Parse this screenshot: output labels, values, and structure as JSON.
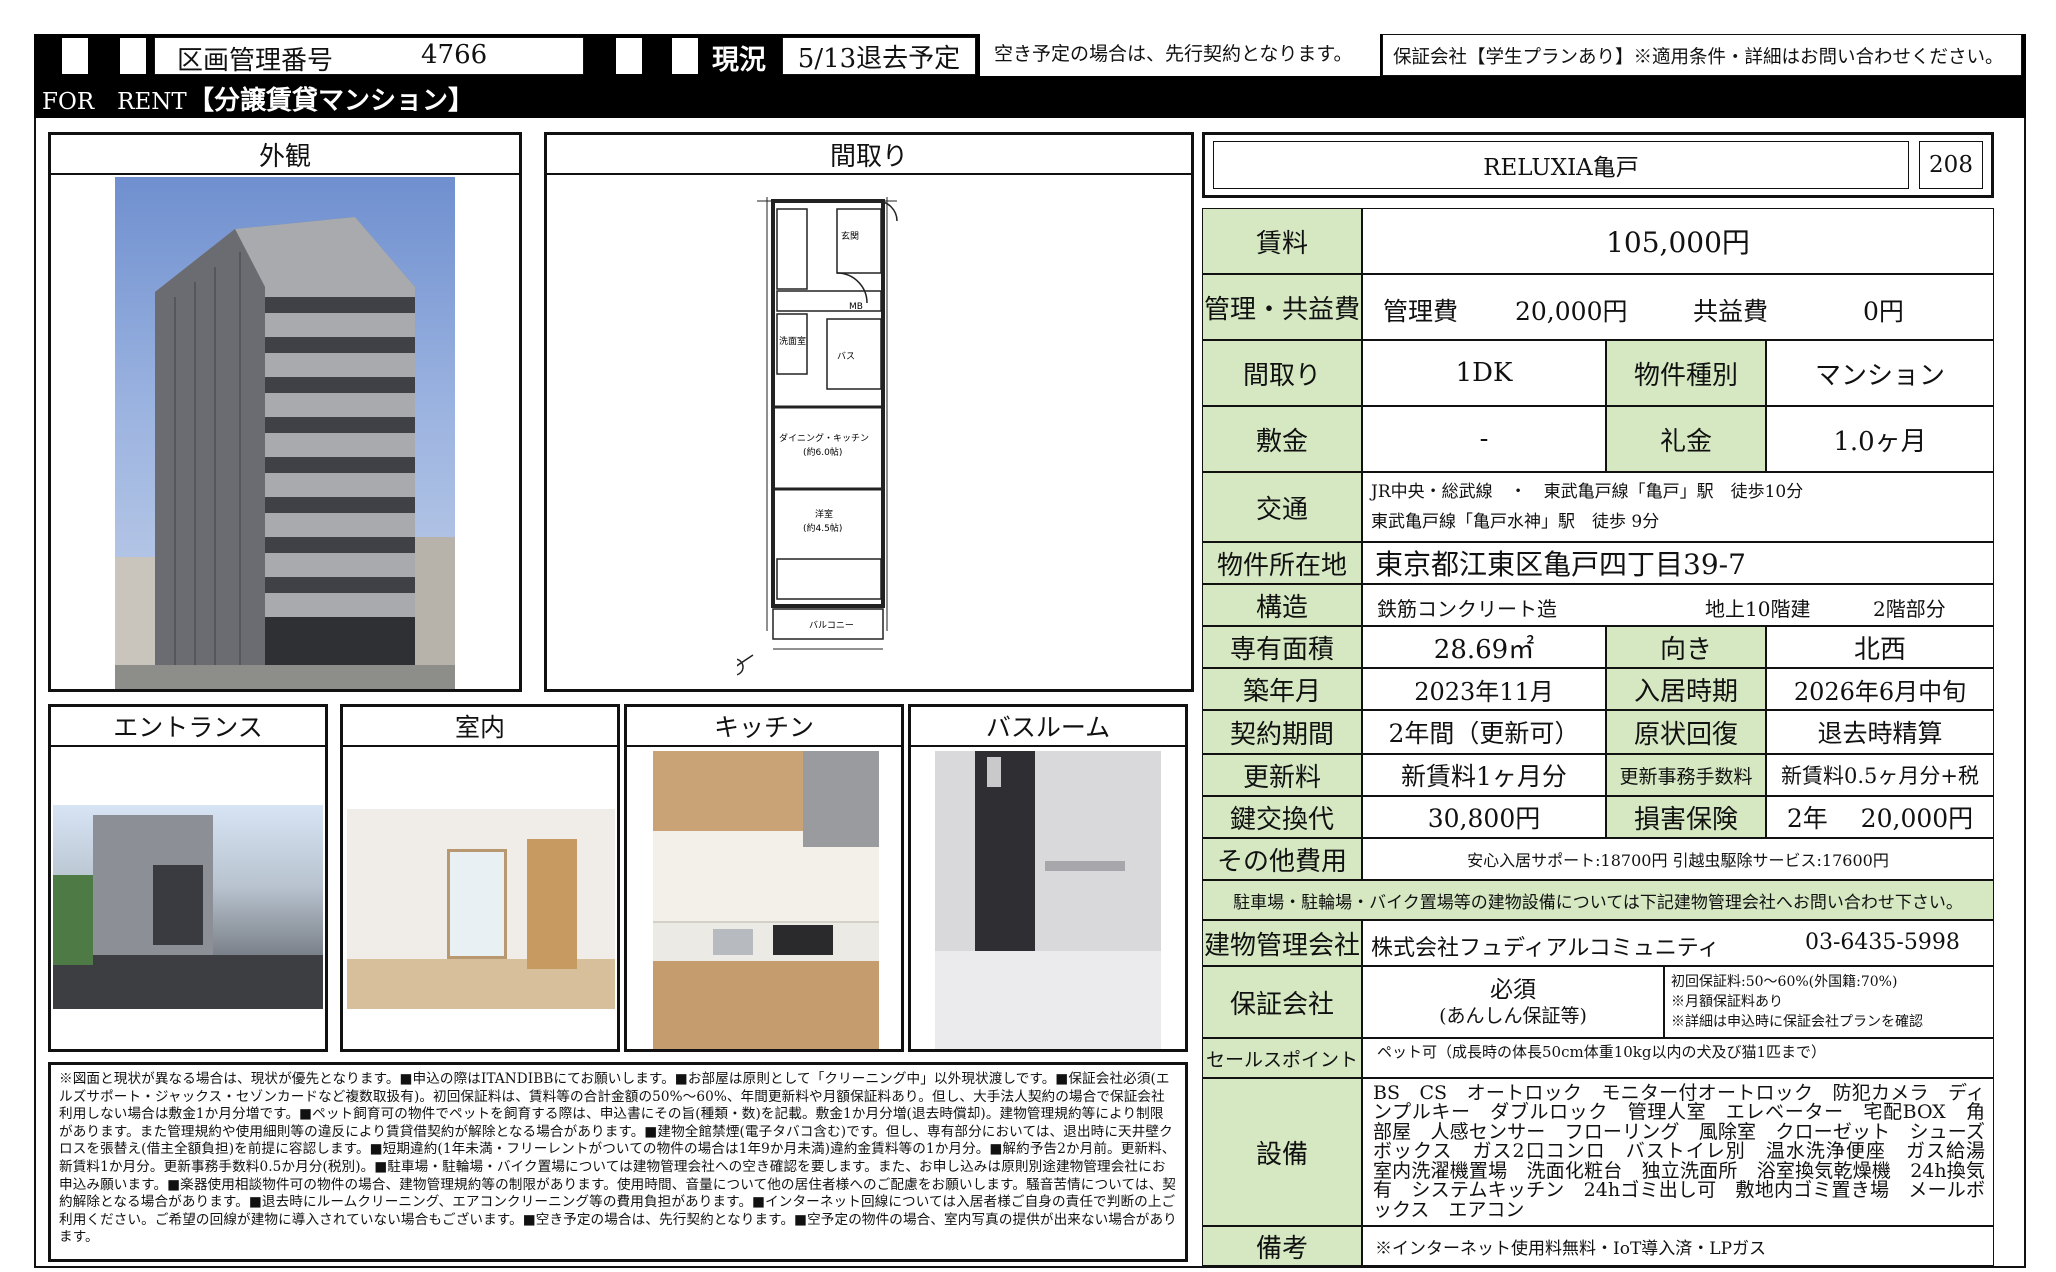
{
  "header": {
    "kukaku_label": "区画管理番号",
    "kukaku_value": "4766",
    "genkyo_label": "現況",
    "genkyo_value": "5/13退去予定",
    "vacancy_note": "空き予定の場合は、先行契約となります。",
    "guarantee_note": "保証会社【学生プランあり】※適用条件・詳細はお問い合わせください。",
    "for_rent": "FOR　RENT",
    "property_type": "【分譲賃貸マンション】"
  },
  "sections": {
    "exterior": "外観",
    "floorplan": "間取り",
    "entrance": "エントランス",
    "interior": "室内",
    "kitchen": "キッチン",
    "bathroom": "バスルーム"
  },
  "floorplan_labels": {
    "entry": "玄関",
    "wash": "洗面室",
    "bath": "バス",
    "dk": "ダイニング・キッチン",
    "dk_size": "(約6.0帖)",
    "western": "洋室",
    "western_size": "(約4.5帖)",
    "balcony": "バルコニー",
    "mbx": "MB"
  },
  "property": {
    "name": "RELUXIA亀戸",
    "room": "208"
  },
  "table": {
    "rent_label": "賃料",
    "rent_value": "105,000円",
    "mgmt_label": "管理・共益費",
    "mgmt_fee_label": "管理費",
    "mgmt_fee_value": "20,000円",
    "common_label": "共益費",
    "common_value": "0円",
    "layout_label": "間取り",
    "layout_value": "1DK",
    "kind_label": "物件種別",
    "kind_value": "マンション",
    "deposit_label": "敷金",
    "deposit_value": "-",
    "key_money_label": "礼金",
    "key_money_value": "1.0ヶ月",
    "access_label": "交通",
    "access_line1": "JR中央・総武線　・　東武亀戸線「亀戸」駅　徒歩10分",
    "access_line2": "東武亀戸線「亀戸水神」駅　徒歩 9分",
    "address_label": "物件所在地",
    "address_value": "東京都江東区亀戸四丁目39-7",
    "structure_label": "構造",
    "structure_value": "鉄筋コンクリート造",
    "floors_value": "地上10階建",
    "floor_part": "2階部分",
    "area_label": "専有面積",
    "area_value": "28.69㎡",
    "direction_label": "向き",
    "direction_value": "北西",
    "built_label": "築年月",
    "built_value": "2023年11月",
    "movein_label": "入居時期",
    "movein_value": "2026年6月中旬",
    "term_label": "契約期間",
    "term_value": "2年間（更新可）",
    "restore_label": "原状回復",
    "restore_value": "退去時精算",
    "renew_label": "更新料",
    "renew_value": "新賃料1ヶ月分",
    "renew_fee_label": "更新事務手数料",
    "renew_fee_value": "新賃料0.5ヶ月分+税",
    "key_label": "鍵交換代",
    "key_value": "30,800円",
    "insurance_label": "損害保険",
    "insurance_value": "2年　 20,000円",
    "other_label": "その他費用",
    "other_value": "安心入居サポート:18700円 引越虫駆除サービス:17600円",
    "parking_note": "駐車場・駐輪場・バイク置場等の建物設備については下記建物管理会社へお問い合わせ下さい。",
    "mgmt_co_label": "建物管理会社",
    "mgmt_co_value": "株式会社フュディアルコミュニティ",
    "mgmt_co_tel": "03-6435-5998",
    "guarantor_label": "保証会社",
    "guarantor_value": "必須",
    "guarantor_sub": "(あんしん保証等)",
    "guarantor_note1": "初回保証料:50～60%(外国籍:70%)",
    "guarantor_note2": "※月額保証料あり",
    "guarantor_note3": "※詳細は申込時に保証会社プランを確認",
    "sales_label": "セールスポイント",
    "sales_value": "ペット可（成長時の体長50cm体重10kg以内の犬及び猫1匹まで）",
    "equip_label": "設備",
    "equip_value": "BS　CS　オートロック　モニター付オートロック　防犯カメラ　ディンプルキー　ダブルロック　管理人室　エレベーター　宅配BOX　角部屋　人感センサー　フローリング　風除室　クローゼット　シューズボックス　ガス2口コンロ　バストイレ別　温水洗浄便座　ガス給湯　室内洗濯機置場　洗面化粧台　独立洗面所　浴室換気乾燥機　24h換気有　システムキッチン　24hゴミ出し可　敷地内ゴミ置き場　メールボックス　エアコン",
    "remarks_label": "備考",
    "remarks_value": "※インターネット使用料無料・IoT導入済・LPガス"
  },
  "disclaimer": "※図面と現状が異なる場合は、現状が優先となります。■申込の際はITANDIBBにてお願いします。■お部屋は原則として「クリーニング中」以外現状渡しです。■保証会社必須(エルズサポート・ジャックス・セゾンカードなど複数取扱有)。初回保証料は、賃料等の合計金額の50%～60%、年間更新料や月額保証料あり。但し、大手法人契約の場合で保証会社利用しない場合は敷金1か月分増です。■ペット飼育可の物件でペットを飼育する際は、申込書にその旨(種類・数)を記載。敷金1か月分増(退去時償却)。建物管理規約等により制限があります。また管理規約や使用細則等の違反により賃貸借契約が解除となる場合があります。■建物全館禁煙(電子タバコ含む)です。但し、専有部分においては、退出時に天井壁クロスを張替え(借主全額負担)を前提に容認します。■短期違約(1年未満・フリーレントがついての物件の場合は1年9か月未満)違約金賃料等の1か月分。■解約予告2か月前。更新料、新賃料1か月分。更新事務手数料0.5か月分(税別)。■駐車場・駐輪場・バイク置場については建物管理会社への空き確認を要します。また、お申し込みは原則別途建物管理会社にお申込み願います。■楽器使用相談物件可の物件の場合、建物管理規約等の制限があります。使用時間、音量について他の居住者様へのご配慮をお願いします。騒音苦情については、契約解除となる場合があります。■退去時にルームクリーニング、エアコンクリーニング等の費用負担があります。■インターネット回線については入居者様ご自身の責任で判断の上ご利用ください。ご希望の回線が建物に導入されていない場合もございます。■空き予定の場合は、先行契約となります。■空予定の物件の場合、室内写真の提供が出来ない場合があります。"
}
